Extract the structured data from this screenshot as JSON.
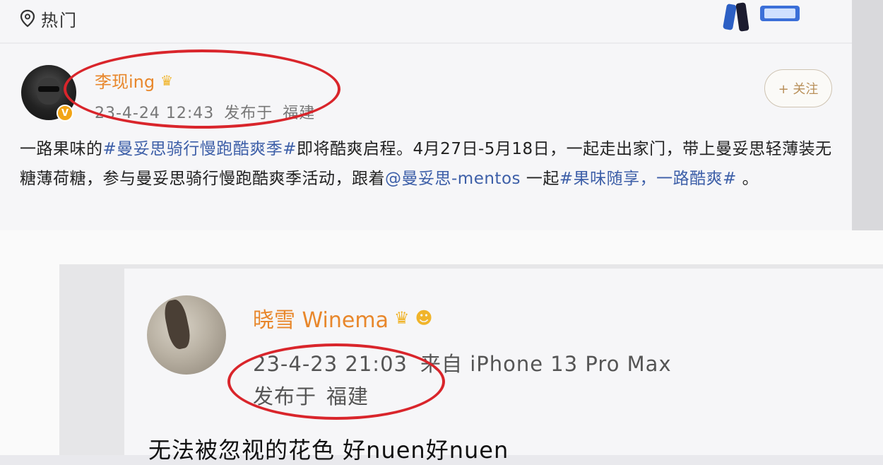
{
  "header": {
    "section_label": "热门",
    "location_icon": "location-pin-icon"
  },
  "post1": {
    "username": "李现ing",
    "badge_icon": "crown-icon",
    "verified_mark": "V",
    "date": "23-4-24 12:43",
    "location_prefix": "发布于",
    "location": "福建",
    "follow_label": "+ 关注",
    "text_1": "一路果味的",
    "tag_1": "#曼妥思骑行慢跑酷爽季#",
    "text_2": "即将酷爽启程。4月27日-5月18日，一起走出家门，带上曼妥思轻薄装无糖薄荷糖，参与曼妥思骑行慢跑酷爽季活动，跟着",
    "mention": "@曼妥思-mentos",
    "text_3": " 一起",
    "tag_2": "#果味随享，一路酷爽#",
    "text_4": " 。"
  },
  "post2": {
    "username": "晓雪 Winema",
    "badge_icons": [
      "crown-icon",
      "emoji-badge-icon"
    ],
    "date": "23-4-23 21:03",
    "source": "来自 iPhone 13 Pro Max",
    "location_prefix": "发布于",
    "location": "福建",
    "text": "无法被忽视的花色  好nuen好nuen"
  },
  "colors": {
    "username": "#e8872b",
    "link": "#3d5fa8",
    "annotation_ring": "#d9252b",
    "follow_text": "#b9905a"
  }
}
